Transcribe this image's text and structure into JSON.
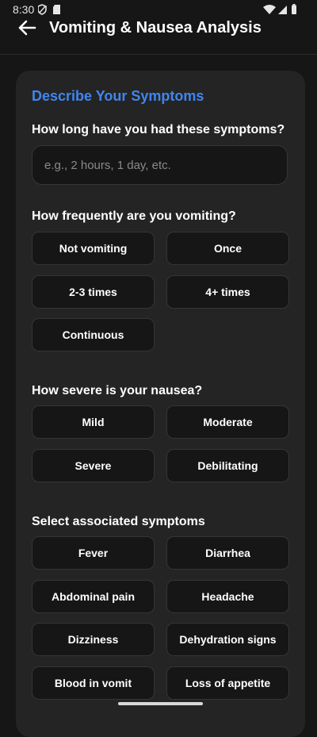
{
  "status_bar": {
    "time": "8:30"
  },
  "header": {
    "title": "Vomiting & Nausea Analysis",
    "back_icon": "arrow-left-icon"
  },
  "colors": {
    "background": "#161616",
    "card": "#242424",
    "accent": "#3f86ef",
    "option_background": "#161616",
    "option_border": "#353535"
  },
  "form": {
    "section_title": "Describe Your Symptoms",
    "duration": {
      "question": "How long have you had these symptoms?",
      "placeholder": "e.g., 2 hours, 1 day, etc.",
      "value": ""
    },
    "frequency": {
      "question": "How frequently are you vomiting?",
      "options": [
        "Not vomiting",
        "Once",
        "2-3 times",
        "4+ times",
        "Continuous"
      ]
    },
    "severity": {
      "question": "How severe is your nausea?",
      "options": [
        "Mild",
        "Moderate",
        "Severe",
        "Debilitating"
      ]
    },
    "associated": {
      "question": "Select associated symptoms",
      "options": [
        "Fever",
        "Diarrhea",
        "Abdominal pain",
        "Headache",
        "Dizziness",
        "Dehydration signs",
        "Blood in vomit",
        "Loss of appetite"
      ]
    }
  }
}
